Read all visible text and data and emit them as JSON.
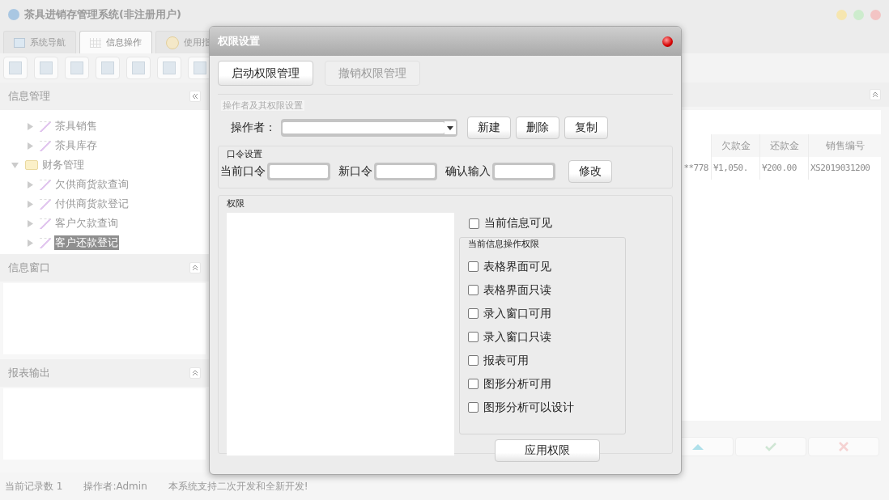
{
  "window": {
    "title": "茶具进销存管理系统(非注册用户)"
  },
  "tabs": [
    {
      "label": "系统导航",
      "selected": false
    },
    {
      "label": "信息操作",
      "selected": true
    },
    {
      "label": "使用指",
      "selected": false
    }
  ],
  "sidebar": {
    "title": "信息管理",
    "tree": {
      "partial_children": [
        {
          "label": "茶具销售",
          "selected": false
        },
        {
          "label": "茶具库存",
          "selected": false
        }
      ],
      "nodes": [
        {
          "label": "财务管理",
          "expanded": true,
          "children": [
            {
              "label": "欠供商货款查询",
              "selected": false
            },
            {
              "label": "付供商货款登记",
              "selected": false
            },
            {
              "label": "客户欠款查询",
              "selected": false
            },
            {
              "label": "客户还款登记",
              "selected": true
            }
          ]
        }
      ]
    },
    "panels": [
      {
        "title": "信息窗口"
      },
      {
        "title": "报表输出"
      }
    ]
  },
  "table": {
    "columns": [
      "",
      "欠款金",
      "还款金",
      "销售编号"
    ],
    "rows": [
      [
        "**778",
        "¥1,050.",
        "¥200.00",
        "XS2019031200"
      ]
    ]
  },
  "status_bar": [
    "当前记录数 1",
    "操作者:Admin",
    "本系统支持二次开发和全新开发!"
  ],
  "dialog": {
    "title": "权限设置",
    "buttons": [
      {
        "label": "启动权限管理",
        "disabled": false
      },
      {
        "label": "撤销权限管理",
        "disabled": true
      }
    ],
    "operator_group": {
      "title": "操作者及其权限设置",
      "label": "操作者：",
      "buttons": [
        "新建",
        "删除",
        "复制"
      ]
    },
    "password_group": {
      "title": "口令设置",
      "fields": [
        "当前口令",
        "新口令",
        "确认输入"
      ],
      "button": "修改"
    },
    "permission_group": {
      "title": "权限",
      "visible": {
        "label": "当前信息可见",
        "checked": false
      },
      "ops_title": "当前信息操作权限",
      "ops": [
        {
          "label": "表格界面可见",
          "checked": false
        },
        {
          "label": "表格界面只读",
          "checked": false
        },
        {
          "label": "录入窗口可用",
          "checked": false
        },
        {
          "label": "录入窗口只读",
          "checked": false
        },
        {
          "label": "报表可用",
          "checked": false
        },
        {
          "label": "图形分析可用",
          "checked": false
        },
        {
          "label": "图形分析可以设计",
          "checked": false
        }
      ],
      "apply": "应用权限"
    }
  }
}
